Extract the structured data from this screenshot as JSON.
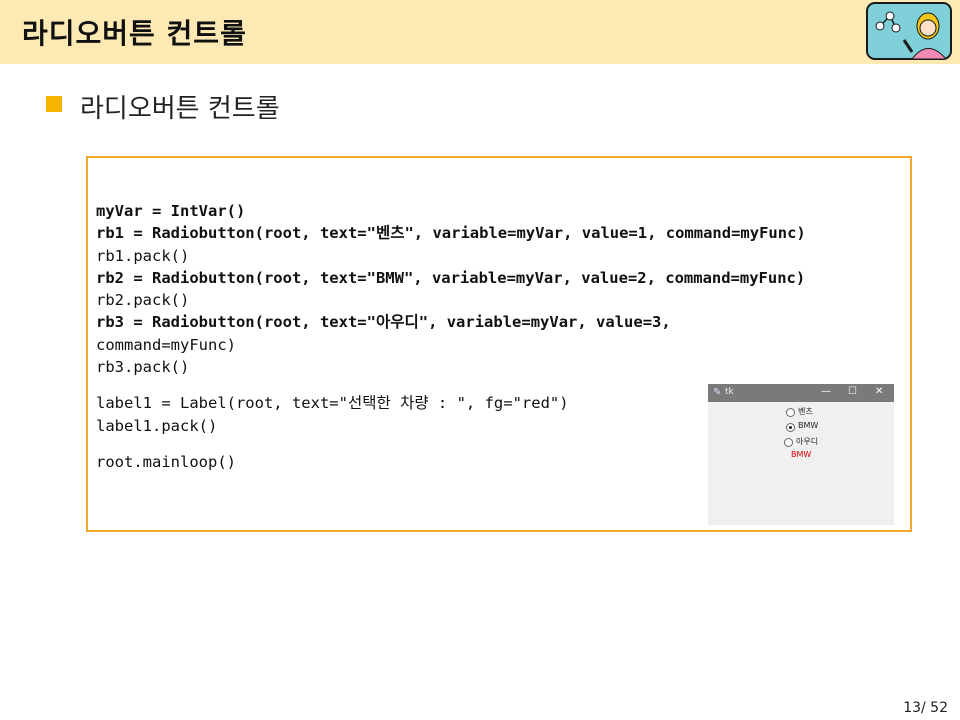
{
  "header": {
    "title": "라디오버튼 컨트롤",
    "avatar_icon": "teacher-avatar-icon"
  },
  "section": {
    "title": "라디오버튼 컨트롤",
    "bullet_color": "#f5b400"
  },
  "code": {
    "lines": [
      "myVar = IntVar()",
      "rb1 = Radiobutton(root, text=\"벤츠\", variable=myVar, value=1, command=myFunc)",
      "rb1.pack()",
      "rb2 = Radiobutton(root, text=\"BMW\", variable=myVar, value=2, command=myFunc)",
      "rb2.pack()",
      "rb3 = Radiobutton(root, text=\"아우디\", variable=myVar, value=3,",
      "command=myFunc)",
      "rb3.pack()",
      "label1 = Label(root, text=\"선택한 차량 : \", fg=\"red\")",
      "label1.pack()",
      "root.mainloop()"
    ]
  },
  "tk_window": {
    "title": "tk",
    "minimize": "—",
    "maximize": "☐",
    "close": "✕",
    "options": [
      "벤츠",
      "BMW",
      "아우디"
    ],
    "selected": "BMW",
    "label": "BMW",
    "label_color": "#e00000"
  },
  "page": {
    "number": "13/ 52"
  }
}
